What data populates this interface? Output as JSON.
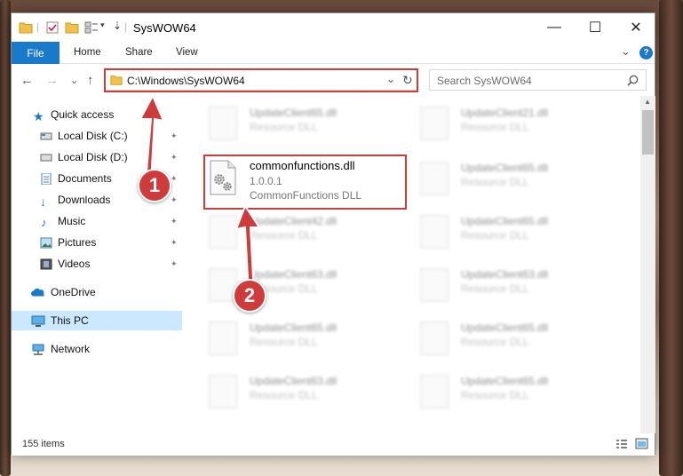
{
  "window": {
    "title": "SysWOW64",
    "controls": {
      "minimize": "—",
      "maximize": "☐",
      "close": "✕"
    }
  },
  "ribbon": {
    "tabs": [
      "File",
      "Home",
      "Share",
      "View"
    ],
    "expand_glyph": "⌄",
    "help_glyph": "?"
  },
  "address": {
    "path": "C:\\Windows\\SysWOW64",
    "refresh_glyph": "↻",
    "dropdown_glyph": "⌄"
  },
  "search": {
    "placeholder": "Search SysWOW64"
  },
  "nav": {
    "back": "←",
    "forward": "→",
    "recent": "⌄",
    "up": "↑"
  },
  "sidebar": {
    "items": [
      {
        "label": "Quick access",
        "icon": "star-icon"
      },
      {
        "label": "Local Disk (C:)",
        "icon": "drive-icon",
        "pinned": true
      },
      {
        "label": "Local Disk (D:)",
        "icon": "drive-icon",
        "pinned": true
      },
      {
        "label": "Documents",
        "icon": "documents-icon",
        "pinned": true
      },
      {
        "label": "Downloads",
        "icon": "downloads-icon",
        "pinned": true
      },
      {
        "label": "Music",
        "icon": "music-icon",
        "pinned": true
      },
      {
        "label": "Pictures",
        "icon": "pictures-icon",
        "pinned": true
      },
      {
        "label": "Videos",
        "icon": "videos-icon",
        "pinned": true
      },
      {
        "label": "OneDrive",
        "icon": "onedrive-icon"
      },
      {
        "label": "This PC",
        "icon": "pc-icon",
        "selected": true
      },
      {
        "label": "Network",
        "icon": "network-icon"
      }
    ],
    "pin_glyph": "📌"
  },
  "files": {
    "highlighted": {
      "name": "commonfunctions.dll",
      "version": "1.0.0.1",
      "description": "CommonFunctions DLL"
    },
    "blurred": [
      {
        "name": "UpdateClient65.dll",
        "description": "Resource DLL"
      },
      {
        "name": "UpdateClient21.dll",
        "description": "Resource DLL"
      },
      {
        "name": "UpdateClient65.dll",
        "description": "Resource DLL"
      },
      {
        "name": "UpdateClient42.dll",
        "description": "Resource DLL"
      },
      {
        "name": "UpdateClient65.dll",
        "description": "Resource DLL"
      },
      {
        "name": "UpdateClient63.dll",
        "description": "Resource DLL"
      },
      {
        "name": "UpdateClient63.dll",
        "description": "Resource DLL"
      },
      {
        "name": "UpdateClient65.dll",
        "description": "Resource DLL"
      },
      {
        "name": "UpdateClient65.dll",
        "description": "Resource DLL"
      },
      {
        "name": "UpdateClient63.dll",
        "description": "Resource DLL"
      },
      {
        "name": "UpdateClient65.dll",
        "description": "Resource DLL"
      }
    ]
  },
  "status": {
    "item_count": "155 items"
  },
  "callouts": [
    "1",
    "2"
  ],
  "colors": {
    "accent": "#1979ca",
    "highlight": "#cf3b3b",
    "selected_bg": "#cce8ff"
  }
}
